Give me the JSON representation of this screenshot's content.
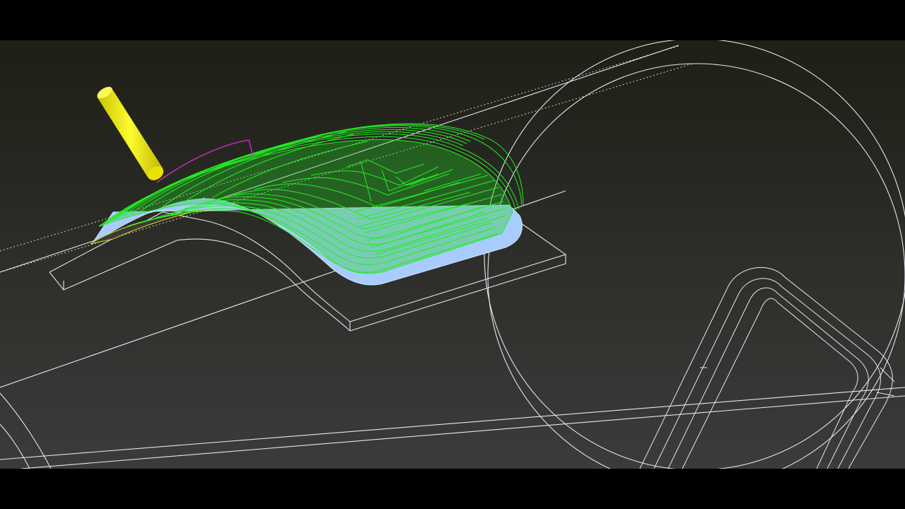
{
  "scene": {
    "description_colors": {
      "viewport_bg_top": "#1f1f17",
      "viewport_bg_bottom": "#3b3b3b",
      "wireframe": "#e6e6f0",
      "toolpath": "#22ee22",
      "finished_surface": "#a8ccff",
      "tool": "#f2ee10",
      "lead_arc": "#cc33cc",
      "stock_yellow_edge": "#d8d820"
    },
    "icons": {
      "tool": "ball-end-mill-icon"
    }
  }
}
